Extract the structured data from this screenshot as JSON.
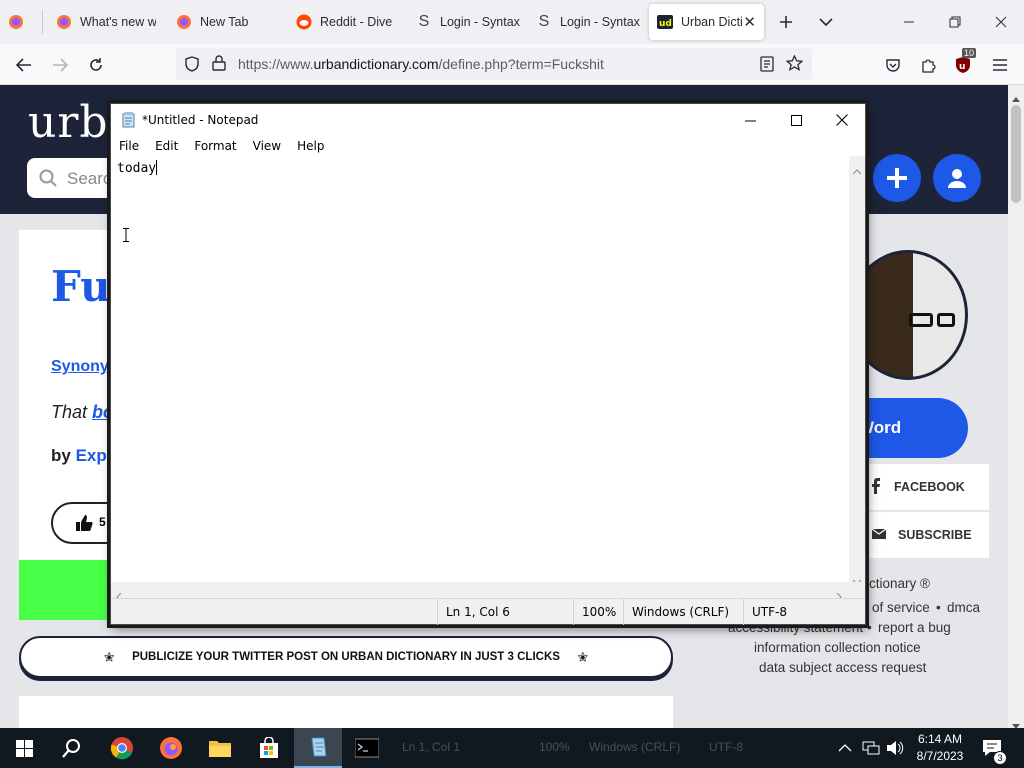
{
  "browser": {
    "tabs": [
      {
        "title": "",
        "icon": "firefox-icon"
      },
      {
        "title": "What's new w",
        "icon": "firefox-icon"
      },
      {
        "title": "New Tab",
        "icon": "firefox-icon"
      },
      {
        "title": "Reddit - Dive i",
        "icon": "reddit-icon"
      },
      {
        "title": "Login - Syntax",
        "icon": "syntax-icon"
      },
      {
        "title": "Login - Syntax",
        "icon": "syntax-icon"
      },
      {
        "title": "Urban Dicti",
        "icon": "urban-dictionary-icon",
        "active": true
      }
    ],
    "url_prefix": "https://www.",
    "url_domain": "urbandictionary.com",
    "url_path": "/define.php?term=Fuckshit",
    "extension_badge": "10"
  },
  "page": {
    "logo": "urb",
    "search_placeholder": "Search",
    "word_title": "Fuc",
    "synonyms": "Synony",
    "meaning_prefix": "That ",
    "meaning_link": "bo",
    "author_prefix": "by ",
    "author_name": "Expo",
    "vote_count": "5",
    "promo_text": "PUBLICIZE YOUR TWITTER POST ON URBAN DICTIONARY IN JUST 3 CLICKS",
    "promo_star": "✬",
    "add_word_label": "Word",
    "facebook_label": "FACEBOOK",
    "subscribe_label": "SUBSCRIBE",
    "footer": {
      "copyright": "ictionary ®",
      "terms": "of service",
      "dmca": "dmca",
      "accessibility": "accessibility statement",
      "report": "report a bug",
      "info_notice": "information collection notice",
      "dsar": "data subject access request"
    }
  },
  "notepad": {
    "title": "*Untitled - Notepad",
    "menu": [
      "File",
      "Edit",
      "Format",
      "View",
      "Help"
    ],
    "content": "today",
    "status": {
      "position": "Ln 1, Col 6",
      "zoom": "100%",
      "line_ending": "Windows (CRLF)",
      "encoding": "UTF-8"
    }
  },
  "taskbar": {
    "ghost_text": [
      "Ln 1, Col 1",
      "100%",
      "Windows (CRLF)",
      "UTF-8"
    ],
    "time": "6:14 AM",
    "date": "8/7/2023",
    "notification_count": "3"
  },
  "colors": {
    "ud_blue": "#1e58e6",
    "ud_navy": "#1d2439",
    "ud_green": "#46ff46"
  }
}
